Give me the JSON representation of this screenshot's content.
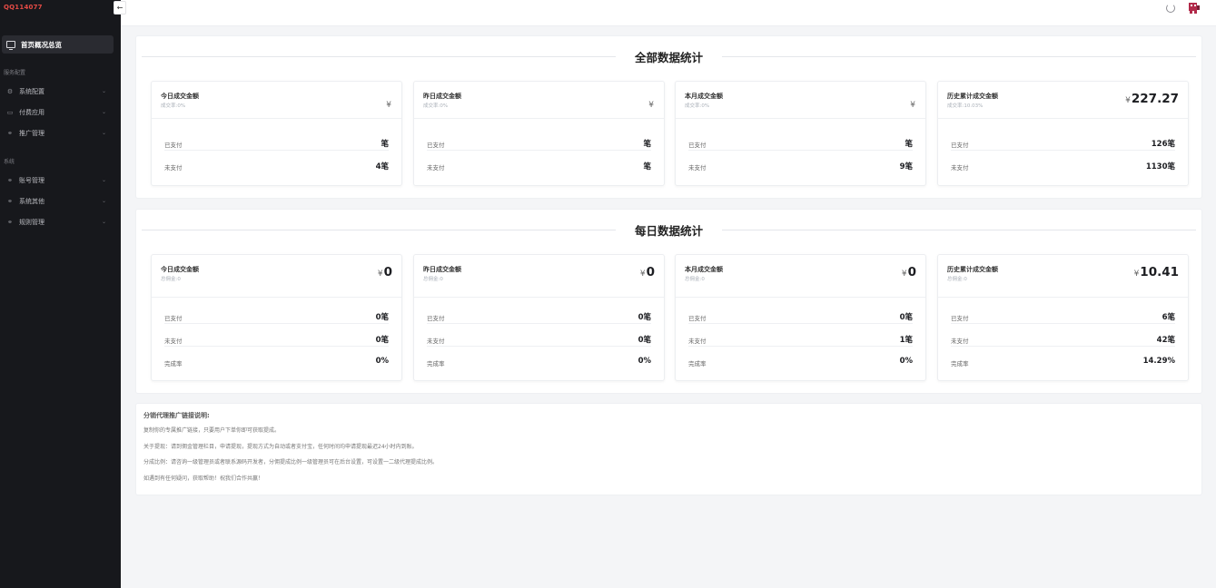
{
  "app": {
    "logo": "QQ114077"
  },
  "sidebar": {
    "active_item": "首页概况总览",
    "sections": [
      {
        "title": "服务配置",
        "items": [
          {
            "label": "系统配置",
            "icon": "gear-icon"
          },
          {
            "label": "付费应用",
            "icon": "card-icon"
          },
          {
            "label": "推广管理",
            "icon": "link-icon"
          }
        ]
      },
      {
        "title": "系统",
        "items": [
          {
            "label": "账号管理",
            "icon": "link-icon"
          },
          {
            "label": "系统其他",
            "icon": "link-icon"
          },
          {
            "label": "规则管理",
            "icon": "link-icon"
          }
        ]
      }
    ]
  },
  "header": {
    "collapse_icon": "←"
  },
  "overall": {
    "title": "全部数据统计",
    "cards": [
      {
        "title": "今日成交金额",
        "sub": "成交率:0%",
        "currency": "¥",
        "amount": "",
        "paid_label": "已支付",
        "paid": "笔",
        "unpaid_label": "未支付",
        "unpaid": "4笔"
      },
      {
        "title": "昨日成交金额",
        "sub": "成交率:0%",
        "currency": "¥",
        "amount": "",
        "paid_label": "已支付",
        "paid": "笔",
        "unpaid_label": "未支付",
        "unpaid": "笔"
      },
      {
        "title": "本月成交金额",
        "sub": "成交率:0%",
        "currency": "¥",
        "amount": "",
        "paid_label": "已支付",
        "paid": "笔",
        "unpaid_label": "未支付",
        "unpaid": "9笔"
      },
      {
        "title": "历史累计成交金额",
        "sub": "成交率:10.03%",
        "currency": "¥",
        "amount": "227.27",
        "paid_label": "已支付",
        "paid": "126笔",
        "unpaid_label": "未支付",
        "unpaid": "1130笔"
      }
    ]
  },
  "daily": {
    "title": "每日数据统计",
    "cards": [
      {
        "title": "今日成交金额",
        "sub": "总佣金:0",
        "currency": "¥",
        "amount": "0",
        "paid_label": "已支付",
        "paid": "0笔",
        "unpaid_label": "未支付",
        "unpaid": "0笔",
        "rate_label": "完成率",
        "rate": "0%"
      },
      {
        "title": "昨日成交金额",
        "sub": "总佣金:0",
        "currency": "¥",
        "amount": "0",
        "paid_label": "已支付",
        "paid": "0笔",
        "unpaid_label": "未支付",
        "unpaid": "0笔",
        "rate_label": "完成率",
        "rate": "0%"
      },
      {
        "title": "本月成交金额",
        "sub": "总佣金:0",
        "currency": "¥",
        "amount": "0",
        "paid_label": "已支付",
        "paid": "0笔",
        "unpaid_label": "未支付",
        "unpaid": "1笔",
        "rate_label": "完成率",
        "rate": "0%"
      },
      {
        "title": "历史累计成交金额",
        "sub": "总佣金:0",
        "currency": "¥",
        "amount": "10.41",
        "paid_label": "已支付",
        "paid": "6笔",
        "unpaid_label": "未支付",
        "unpaid": "42笔",
        "rate_label": "完成率",
        "rate": "14.29%"
      }
    ]
  },
  "notes": {
    "title": "分销代理推广链接说明:",
    "lines": [
      "复制你的专属推广链接，只要用户下单你即可获取提成。",
      "关于提现：请到佣金管理栏目，申请提现，提现方式为自动或者支付宝，任何时间均申请提现最迟24小时内到账。",
      "分成比例：请咨询一级管理员或者联系源码开发者，分佣提成比例一级管理员可在后台设置，可设置一二级代理提成比例。",
      "如遇到有任何疑问，获取帮助！祝我们合作共赢！"
    ]
  }
}
